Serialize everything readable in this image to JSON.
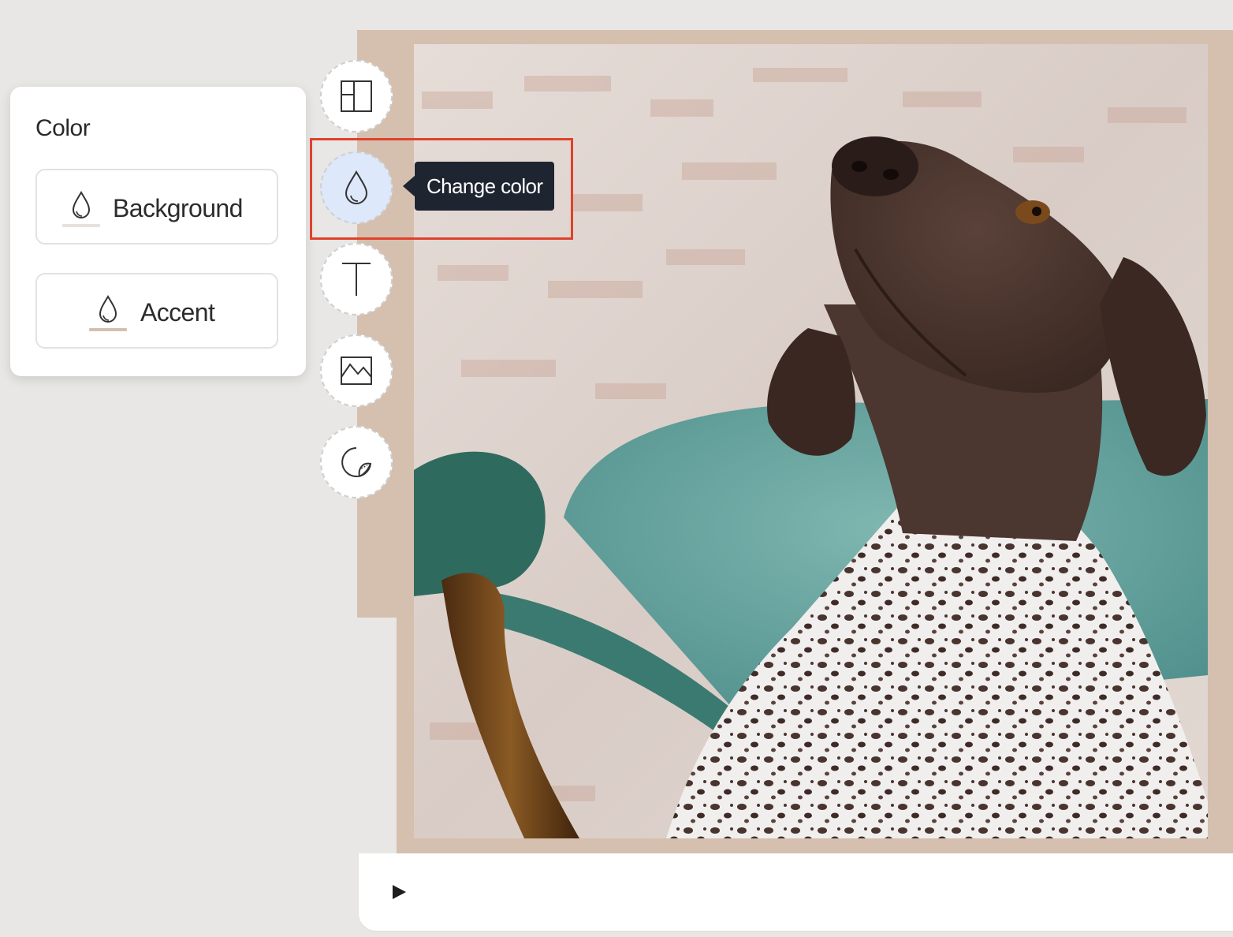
{
  "color_panel": {
    "title": "Color",
    "options": [
      {
        "label": "Background",
        "icon": "droplet-icon",
        "swatch_color": "#e8e1dc"
      },
      {
        "label": "Accent",
        "icon": "droplet-icon",
        "swatch_color": "#d5bfae"
      }
    ]
  },
  "toolbar": {
    "tools": [
      {
        "name": "layout",
        "icon": "layout-icon",
        "active": false
      },
      {
        "name": "color",
        "icon": "droplet-icon",
        "active": true
      },
      {
        "name": "text",
        "icon": "text-icon",
        "active": false
      },
      {
        "name": "image",
        "icon": "image-icon",
        "active": false
      },
      {
        "name": "sticker",
        "icon": "sticker-icon",
        "active": false
      }
    ],
    "tooltip": "Change color"
  },
  "card": {
    "frame_color": "#d5bfae"
  },
  "player": {
    "play_icon": "play-icon"
  },
  "colors": {
    "page_background": "#e8e7e5",
    "highlight": "#e0412b",
    "tooltip_background": "#1f2530",
    "active_tool": "#dde8fb"
  }
}
